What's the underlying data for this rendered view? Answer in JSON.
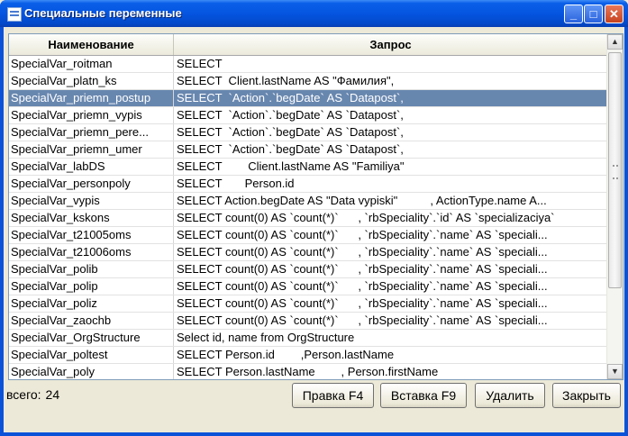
{
  "window": {
    "title": "Специальные переменные",
    "controls": {
      "minimize": "_",
      "maximize": "□",
      "close": "✕"
    }
  },
  "table": {
    "columns": [
      "Наименование",
      "Запрос"
    ],
    "rows": [
      {
        "name": "SpecialVar_roitman",
        "query": "SELECT",
        "selected": false
      },
      {
        "name": "SpecialVar_platn_ks",
        "query": "SELECT  Client.lastName AS \"Фамилия\",",
        "selected": false
      },
      {
        "name": "SpecialVar_priemn_postup",
        "query": "SELECT  `Action`.`begDate` AS `Datapost`,",
        "selected": true
      },
      {
        "name": "SpecialVar_priemn_vypis",
        "query": "SELECT  `Action`.`begDate` AS `Datapost`,",
        "selected": false
      },
      {
        "name": "SpecialVar_priemn_pere...",
        "query": "SELECT  `Action`.`begDate` AS `Datapost`,",
        "selected": false
      },
      {
        "name": "SpecialVar_priemn_umer",
        "query": "SELECT  `Action`.`begDate` AS `Datapost`,",
        "selected": false
      },
      {
        "name": "SpecialVar_labDS",
        "query": "SELECT        Client.lastName AS \"Familiya\"",
        "selected": false
      },
      {
        "name": "SpecialVar_personpoly",
        "query": "SELECT       Person.id",
        "selected": false
      },
      {
        "name": "SpecialVar_vypis",
        "query": "SELECT Action.begDate AS \"Data vypiski\"          , ActionType.name A...",
        "selected": false
      },
      {
        "name": "SpecialVar_kskons",
        "query": "SELECT count(0) AS `count(*)`      , `rbSpeciality`.`id` AS `specializaciya`",
        "selected": false
      },
      {
        "name": "SpecialVar_t21005oms",
        "query": "SELECT count(0) AS `count(*)`      , `rbSpeciality`.`name` AS `speciali...",
        "selected": false
      },
      {
        "name": "SpecialVar_t21006oms",
        "query": "SELECT count(0) AS `count(*)`      , `rbSpeciality`.`name` AS `speciali...",
        "selected": false
      },
      {
        "name": "SpecialVar_polib",
        "query": "SELECT count(0) AS `count(*)`      , `rbSpeciality`.`name` AS `speciali...",
        "selected": false
      },
      {
        "name": "SpecialVar_polip",
        "query": "SELECT count(0) AS `count(*)`      , `rbSpeciality`.`name` AS `speciali...",
        "selected": false
      },
      {
        "name": "SpecialVar_poliz",
        "query": "SELECT count(0) AS `count(*)`      , `rbSpeciality`.`name` AS `speciali...",
        "selected": false
      },
      {
        "name": "SpecialVar_zaochb",
        "query": "SELECT count(0) AS `count(*)`      , `rbSpeciality`.`name` AS `speciali...",
        "selected": false
      },
      {
        "name": "SpecialVar_OrgStructure",
        "query": "Select id, name from OrgStructure",
        "selected": false
      },
      {
        "name": "SpecialVar_poltest",
        "query": "SELECT Person.id        ,Person.lastName",
        "selected": false
      },
      {
        "name": "SpecialVar_poly",
        "query": "SELECT Person.lastName        , Person.firstName",
        "selected": false
      }
    ]
  },
  "footer": {
    "count_label": "всего:",
    "count_value": "24"
  },
  "buttons": {
    "edit": "Правка F4",
    "insert": "Вставка F9",
    "delete": "Удалить",
    "close": "Закрыть"
  },
  "colors": {
    "titlebar": "#0555e0",
    "selection": "#6887af",
    "window_bg": "#ece9d8"
  }
}
